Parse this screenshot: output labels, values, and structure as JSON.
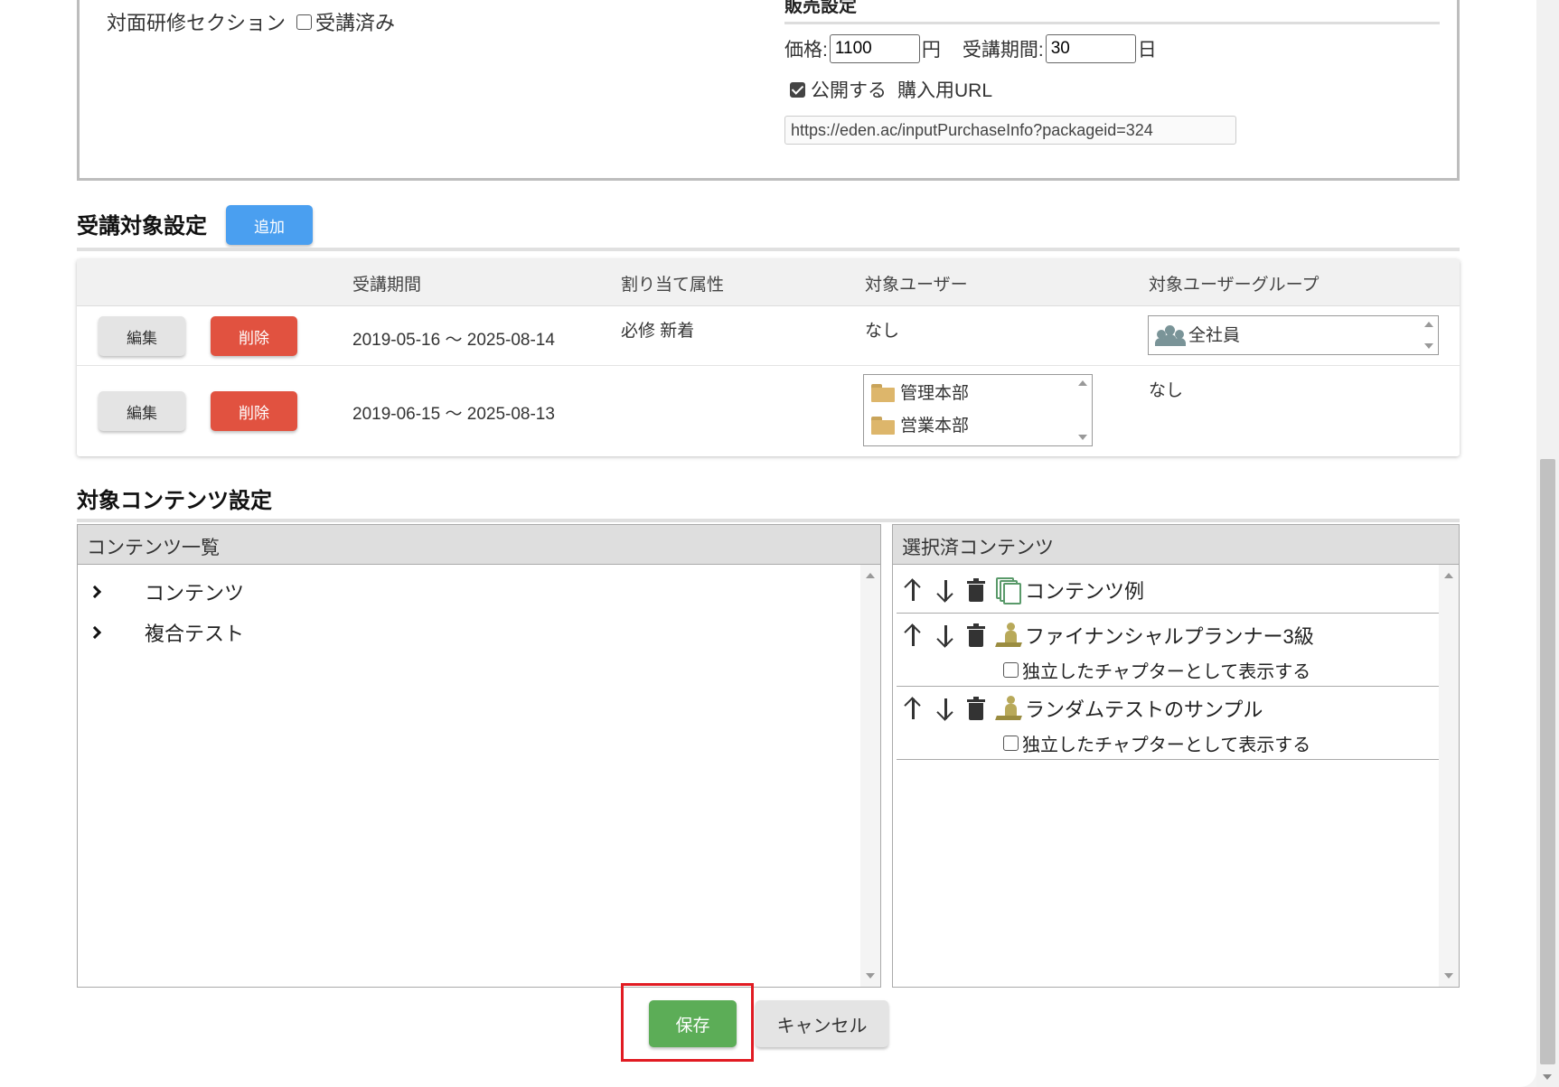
{
  "face_section": {
    "label": "対面研修セクション",
    "attended_label": "受講済み",
    "attended_checked": false
  },
  "sales_settings": {
    "title": "販売設定",
    "price_label": "価格:",
    "price_value": "1100",
    "price_unit": "円",
    "period_label": "受講期間:",
    "period_value": "30",
    "period_unit": "日",
    "publish_label": "公開する",
    "publish_checked": true,
    "purchase_url_label": "購入用URL",
    "purchase_url": "https://eden.ac/inputPurchaseInfo?packageid=324"
  },
  "target_settings": {
    "title": "受講対象設定",
    "add_label": "追加",
    "columns": [
      "受講期間",
      "割り当て属性",
      "対象ユーザー",
      "対象ユーザーグループ"
    ],
    "edit_label": "編集",
    "delete_label": "削除",
    "rows": [
      {
        "period": "2019-05-16 ～ 2025-08-14",
        "attributes": "必修 新着",
        "users": "なし",
        "user_groups": [
          "全社員"
        ]
      },
      {
        "period": "2019-06-15 ～ 2025-08-13",
        "attributes": "",
        "users": [
          "管理本部",
          "営業本部"
        ],
        "user_groups": "なし"
      }
    ]
  },
  "content_settings": {
    "title": "対象コンテンツ設定",
    "list_panel": {
      "header": "コンテンツ一覧",
      "items": [
        "コンテンツ",
        "複合テスト"
      ]
    },
    "selected_panel": {
      "header": "選択済コンテンツ",
      "items": [
        {
          "label": "コンテンツ例",
          "icon": "contents-icon",
          "has_chapter_option": false
        },
        {
          "label": "ファイナンシャルプランナー3級",
          "icon": "test-icon",
          "has_chapter_option": true,
          "chapter_option_label": "独立したチャプターとして表示する",
          "chapter_checked": false
        },
        {
          "label": "ランダムテストのサンプル",
          "icon": "test-icon",
          "has_chapter_option": true,
          "chapter_option_label": "独立したチャプターとして表示する",
          "chapter_checked": false
        }
      ]
    }
  },
  "actions": {
    "save_label": "保存",
    "cancel_label": "キャンセル"
  },
  "colors": {
    "add_button": "#4a9ff0",
    "delete_button": "#e15240",
    "save_button": "#5cad57",
    "highlight": "#e11b22"
  }
}
